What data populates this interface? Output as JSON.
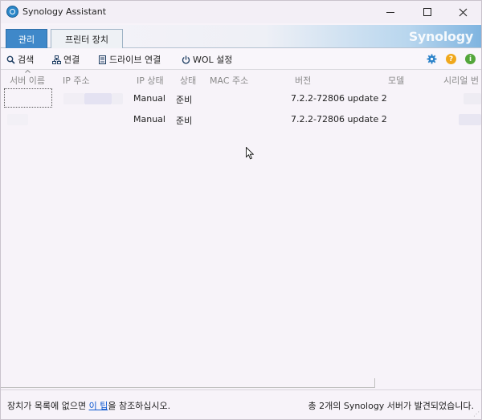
{
  "window": {
    "title": "Synology Assistant"
  },
  "tabs": [
    {
      "label": "관리",
      "active": true
    },
    {
      "label": "프린터 장치",
      "active": false
    }
  ],
  "brand": "Synology",
  "toolbar": {
    "search": "검색",
    "connect": "연결",
    "map_drive": "드라이브 연결",
    "wol": "WOL 설정"
  },
  "columns": [
    "서버 이름",
    "IP 주소",
    "IP 상태",
    "상태",
    "MAC 주소",
    "버전",
    "모델",
    "시리얼 번"
  ],
  "rows": [
    {
      "server_name": "",
      "ip": "",
      "ip_status": "Manual",
      "status": "준비",
      "mac": "",
      "version": "7.2.2-72806 update 2",
      "model": "",
      "serial": ""
    },
    {
      "server_name": "",
      "ip": "",
      "ip_status": "Manual",
      "status": "준비",
      "mac": "",
      "version": "7.2.2-72806 update 2",
      "model": "",
      "serial": ""
    }
  ],
  "status": {
    "left_prefix": "장치가 목록에 없으면 ",
    "left_link": "이 팁",
    "left_suffix": "을 참조하십시오.",
    "right": "총 2개의 Synology 서버가 발견되었습니다."
  },
  "colors": {
    "accent": "#3f88c9",
    "link": "#0b57d0",
    "help": "#f0a81c",
    "info": "#53a63a"
  }
}
